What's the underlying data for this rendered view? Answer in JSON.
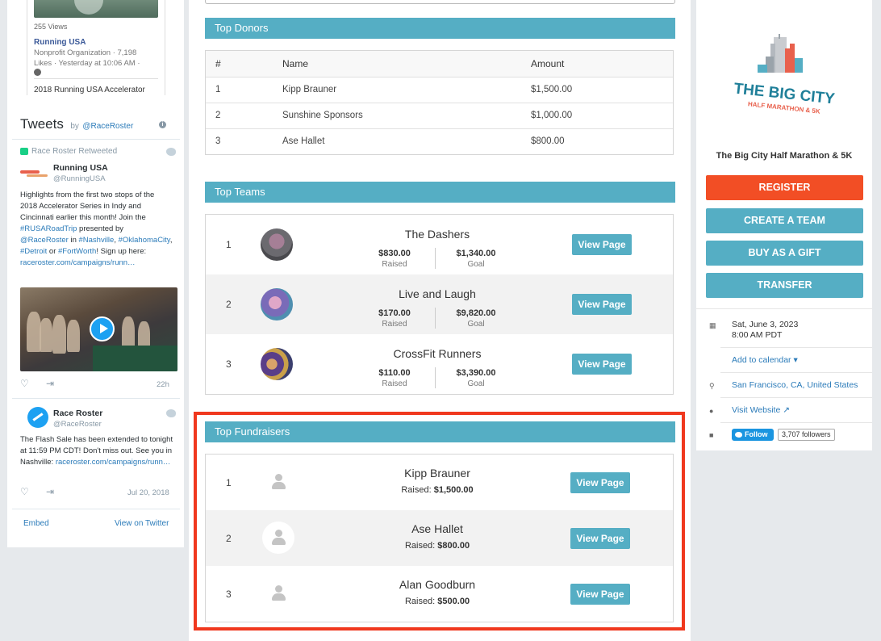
{
  "facebook": {
    "views": "255 Views",
    "page_name": "Running USA",
    "meta": "Nonprofit Organization · 7,198 Likes · Yesterday at 10:06 AM ·",
    "post_title": "2018 Running USA Accelerator"
  },
  "tweets": {
    "title": "Tweets",
    "by": "by",
    "handle_link": "@RaceRoster",
    "retweet_label": "Race Roster Retweeted",
    "tweet1": {
      "name": "Running USA",
      "handle": "@RunningUSA",
      "text_a": "Highlights from the first two stops of the 2018 Accelerator Series in Indy and Cincinnati earlier this month! Join the",
      "hashtag1": "#RUSARoadTrip",
      "text_b": "presented by",
      "mention": "@RaceRoster",
      "text_c": "in",
      "hashtag2": "#Nashville",
      "hashtag3": "#OklahomaCity",
      "hashtag4": "#Detroit",
      "text_or": "or",
      "hashtag5": "#FortWorth",
      "text_d": "Sign up here:",
      "link": "raceroster.com/campaigns/runn…",
      "time": "22h"
    },
    "tweet2": {
      "name": "Race Roster",
      "handle": "@RaceRoster",
      "text": "The Flash Sale has been extended to tonight at 11:59 PM CDT! Don't miss out. See you in Nashville:",
      "link": "raceroster.com/campaigns/runn…",
      "time": "Jul 20, 2018"
    },
    "embed": "Embed",
    "view_on_twitter": "View on Twitter"
  },
  "top_donors": {
    "title": "Top Donors",
    "headers": [
      "#",
      "Name",
      "Amount"
    ],
    "rows": [
      {
        "rank": "1",
        "name": "Kipp Brauner",
        "amount": "$1,500.00"
      },
      {
        "rank": "2",
        "name": "Sunshine Sponsors",
        "amount": "$1,000.00"
      },
      {
        "rank": "3",
        "name": "Ase Hallet",
        "amount": "$800.00"
      }
    ]
  },
  "top_teams": {
    "title": "Top Teams",
    "raised_label": "Raised",
    "goal_label": "Goal",
    "button": "View Page",
    "rows": [
      {
        "rank": "1",
        "name": "The Dashers",
        "raised": "$830.00",
        "goal": "$1,340.00"
      },
      {
        "rank": "2",
        "name": "Live and Laugh",
        "raised": "$170.00",
        "goal": "$9,820.00"
      },
      {
        "rank": "3",
        "name": "CrossFit Runners",
        "raised": "$110.00",
        "goal": "$3,390.00"
      }
    ]
  },
  "top_fundraisers": {
    "title": "Top Fundraisers",
    "raised_prefix": "Raised:",
    "button": "View Page",
    "rows": [
      {
        "rank": "1",
        "name": "Kipp Brauner",
        "raised": "$1,500.00"
      },
      {
        "rank": "2",
        "name": "Ase Hallet",
        "raised": "$800.00"
      },
      {
        "rank": "3",
        "name": "Alan Goodburn",
        "raised": "$500.00"
      }
    ]
  },
  "event": {
    "logo_line1": "THE BIG CITY",
    "logo_line2": "HALF MARATHON & 5K",
    "name": "The Big City Half Marathon & 5K",
    "register": "REGISTER",
    "create_team": "CREATE A TEAM",
    "buy_gift": "BUY AS A GIFT",
    "transfer": "TRANSFER",
    "date": "Sat, June 3, 2023",
    "time": "8:00 AM PDT",
    "add_calendar": "Add to calendar",
    "location": "San Francisco, CA, United States",
    "website": "Visit Website",
    "follow": "Follow",
    "followers": "3,707 followers"
  },
  "colors": {
    "accent": "#55aec4",
    "register": "#f24e25",
    "highlight": "#f0381e",
    "twitter": "#1da1f2"
  }
}
